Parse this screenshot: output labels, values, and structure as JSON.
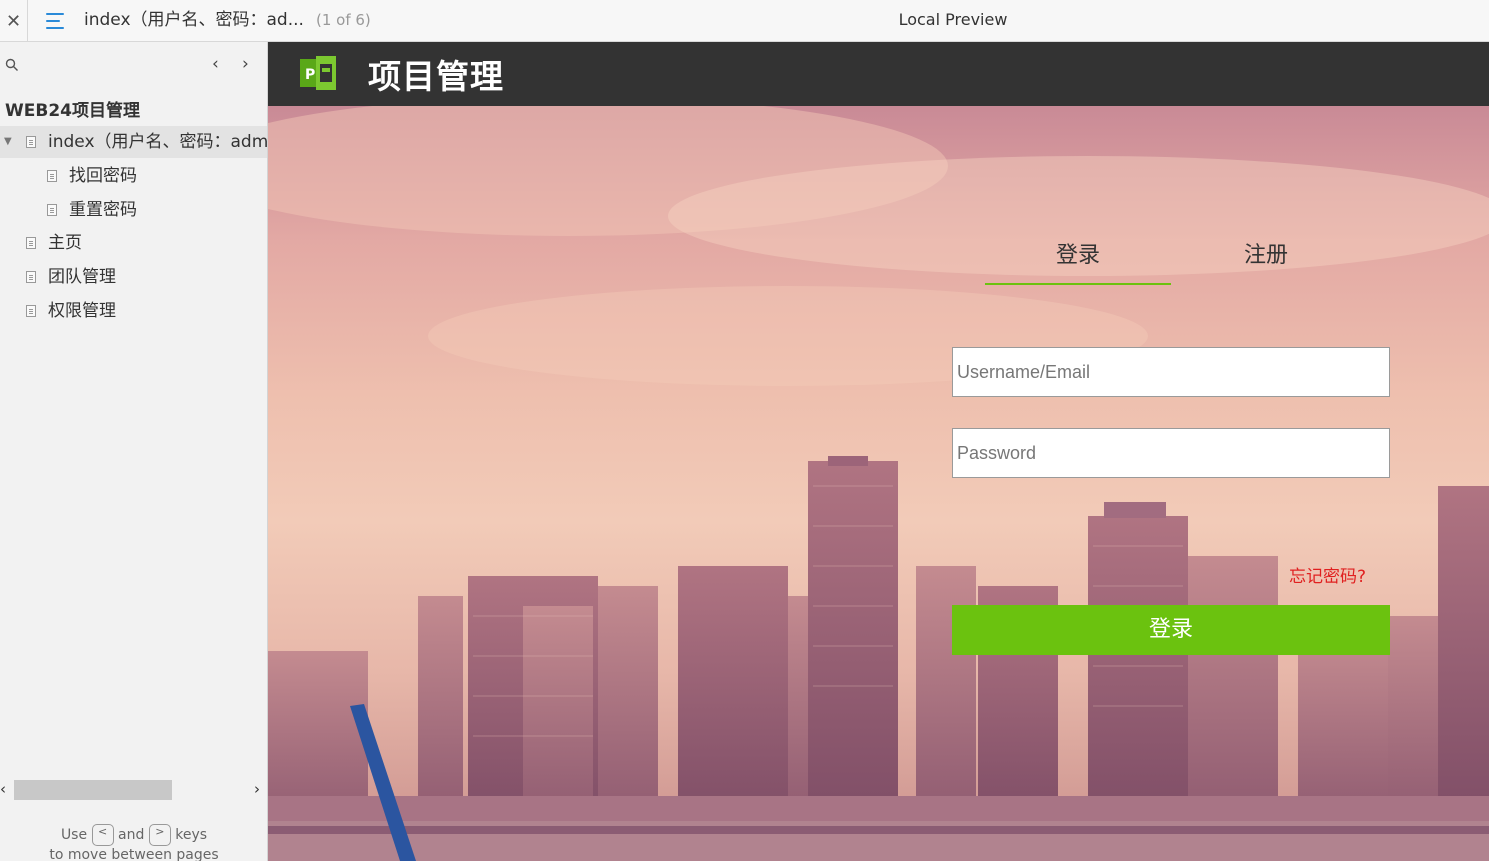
{
  "topbar": {
    "close_icon": "close-icon",
    "menu_icon": "menu-icon",
    "page_title": "index（用户名、密码：ad...",
    "page_counter": "(1 of 6)",
    "preview_title": "Local Preview"
  },
  "sidebar": {
    "search_icon": "search-icon",
    "project_name": "WEB24项目管理",
    "items": [
      {
        "label": "index（用户名、密码：admin）",
        "level": 0,
        "selected": true,
        "expanded": true
      },
      {
        "label": "找回密码",
        "level": 1
      },
      {
        "label": "重置密码",
        "level": 1
      },
      {
        "label": "主页",
        "level": 0
      },
      {
        "label": "团队管理",
        "level": 0
      },
      {
        "label": "权限管理",
        "level": 0
      }
    ],
    "hint_use": "Use",
    "hint_and": "and",
    "hint_keys": "keys",
    "hint_line2": "to move between pages",
    "key_prev": "<",
    "key_next": ">"
  },
  "app": {
    "title": "项目管理",
    "logo_letter": "P",
    "header_color": "#333333",
    "accent_color": "#6bc20f"
  },
  "login": {
    "tab_login": "登录",
    "tab_register": "注册",
    "username_placeholder": "Username/Email",
    "password_placeholder": "Password",
    "forgot_password": "忘记密码?",
    "submit_label": "登录"
  }
}
